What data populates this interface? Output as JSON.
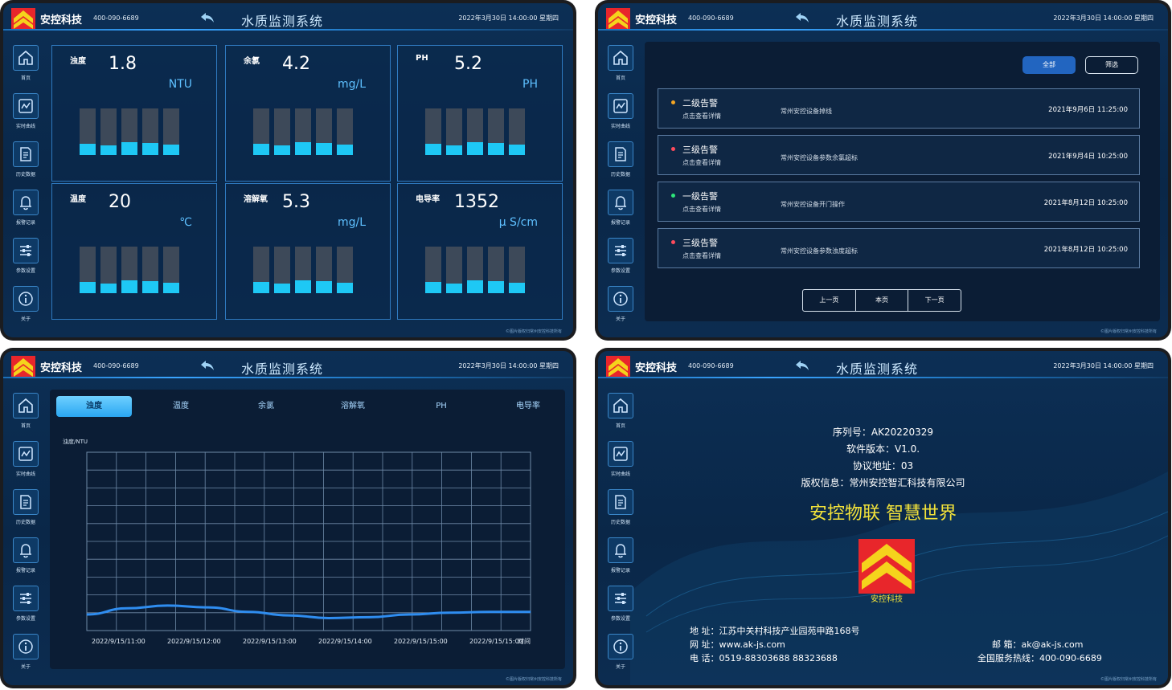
{
  "brand": "安控科技",
  "phone": "400-090-6689",
  "system_title": "水质监测系统",
  "datetime": "2022年3月30日 14:00:00  星期四",
  "footer_note": "©图片版权归常州安控科技所有",
  "nav": [
    "首页",
    "实时曲线",
    "历史数据",
    "报警记录",
    "参数设置",
    "关于"
  ],
  "screen1": {
    "cards": [
      {
        "name": "浊度",
        "value": "1.8",
        "unit": "NTU",
        "fills": [
          0.25,
          0.2,
          0.28,
          0.26,
          0.22
        ]
      },
      {
        "name": "余氯",
        "value": "4.2",
        "unit": "mg/L",
        "fills": [
          0.25,
          0.2,
          0.28,
          0.26,
          0.22
        ]
      },
      {
        "name": "PH",
        "value": "5.2",
        "unit": "PH",
        "fills": [
          0.25,
          0.2,
          0.28,
          0.26,
          0.22
        ]
      },
      {
        "name": "温度",
        "value": "20",
        "unit": "℃",
        "fills": [
          0.25,
          0.2,
          0.28,
          0.26,
          0.22
        ]
      },
      {
        "name": "溶解氧",
        "value": "5.3",
        "unit": "mg/L",
        "fills": [
          0.25,
          0.2,
          0.28,
          0.26,
          0.22
        ]
      },
      {
        "name": "电导率",
        "value": "1352",
        "unit": "μ S/cm",
        "fills": [
          0.25,
          0.2,
          0.28,
          0.26,
          0.22
        ]
      }
    ]
  },
  "screen2": {
    "btn_all": "全部",
    "btn_filter": "筛选",
    "alarms": [
      {
        "level": "二级告警",
        "tip": "点击查看详情",
        "desc": "常州安控设备掉线",
        "time": "2021年9月6日 11:25:00",
        "color": "#f5a623"
      },
      {
        "level": "三级告警",
        "tip": "点击查看详情",
        "desc": "常州安控设备参数余氯超标",
        "time": "2021年9月4日 10:25:00",
        "color": "#ff4b5c"
      },
      {
        "level": "一级告警",
        "tip": "点击查看详情",
        "desc": "常州安控设备开门操作",
        "time": "2021年8月12日 10:25:00",
        "color": "#2ee67a"
      },
      {
        "level": "三级告警",
        "tip": "点击查看详情",
        "desc": "常州安控设备参数浊度超标",
        "time": "2021年8月12日 10:25:00",
        "color": "#ff4b5c"
      }
    ],
    "pager": [
      "上一页",
      "本页",
      "下一页"
    ]
  },
  "screen3": {
    "tabs": [
      "浊度",
      "温度",
      "余氯",
      "溶解氧",
      "PH",
      "电导率"
    ],
    "active_tab": 0
  },
  "chart_data": {
    "type": "line",
    "title": "",
    "ylabel": "浊度/NTU",
    "xlabel": "时间",
    "categories": [
      "2022/9/15/11:00",
      "2022/9/15/12:00",
      "2022/9/15/13:00",
      "2022/9/15/14:00",
      "2022/9/15/15:00",
      "2022/9/15/15:00"
    ],
    "x": [
      0,
      0.5,
      1,
      1.5,
      2,
      2.5,
      3,
      3.5,
      4,
      4.5,
      5,
      5.5
    ],
    "values": [
      0.9,
      1.25,
      1.4,
      1.3,
      1.05,
      0.85,
      0.7,
      0.75,
      0.9,
      1.0,
      1.05,
      1.05
    ],
    "ylim": [
      0,
      10
    ],
    "grid": true
  },
  "screen4": {
    "serial": "序列号：AK20220329",
    "version": "软件版本：V1.0.",
    "protocol": "协议地址：03",
    "copyright": "版权信息：常州安控智汇科技有限公司",
    "slogan": "安控物联  智慧世界",
    "logo_text": "安控科技",
    "address": "地        址：江苏中关村科技产业园苑申路168号",
    "website": "网        址：www.ak-js.com",
    "tel": "电        话：0519-88303688  88323688",
    "email": "邮        箱：ak@ak-js.com",
    "hotline": "全国服务热线：400-090-6689"
  }
}
